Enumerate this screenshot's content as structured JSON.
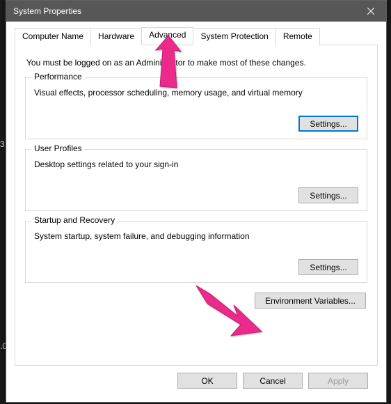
{
  "window": {
    "title": "System Properties"
  },
  "tabs": {
    "items": [
      {
        "label": "Computer Name"
      },
      {
        "label": "Hardware"
      },
      {
        "label": "Advanced"
      },
      {
        "label": "System Protection"
      },
      {
        "label": "Remote"
      }
    ],
    "active_index": 2
  },
  "panel": {
    "intro": "You must be logged on as an Administrator to make most of these changes.",
    "performance": {
      "title": "Performance",
      "desc": "Visual effects, processor scheduling, memory usage, and virtual memory",
      "button": "Settings..."
    },
    "user_profiles": {
      "title": "User Profiles",
      "desc": "Desktop settings related to your sign-in",
      "button": "Settings..."
    },
    "startup_recovery": {
      "title": "Startup and Recovery",
      "desc": "System startup, system failure, and debugging information",
      "button": "Settings..."
    },
    "env_button": "Environment Variables..."
  },
  "dialog_buttons": {
    "ok": "OK",
    "cancel": "Cancel",
    "apply": "Apply"
  },
  "annotations": {
    "arrow_color": "#ec2a8b"
  },
  "edge_artifacts": {
    "a": "3.",
    "b": ".0"
  }
}
